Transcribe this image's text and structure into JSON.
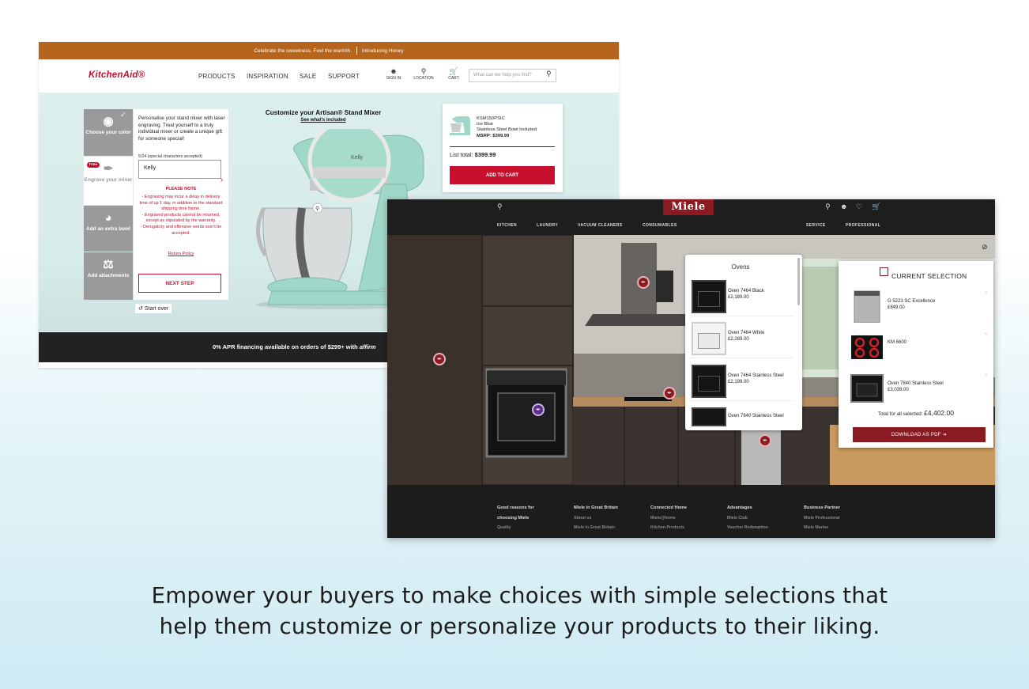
{
  "kitchenaid": {
    "promo": {
      "left": "Celebrate the sweetness. Feel the warmth.",
      "right": "Introducing Honey"
    },
    "logo": "KitchenAid®",
    "nav": [
      "PRODUCTS",
      "INSPIRATION",
      "SALE",
      "SUPPORT"
    ],
    "util": {
      "signin": "SIGN IN",
      "location": "LOCATION",
      "cart": "CART"
    },
    "search_placeholder": "What can we help you find?",
    "steps": [
      {
        "label": "Choose your color",
        "icon": "palette-icon"
      },
      {
        "label": "Engrave your mixer",
        "icon": "pen-nib-icon",
        "badge": "Free"
      },
      {
        "label": "Add an extra bowl",
        "icon": "bowl-icon"
      },
      {
        "label": "Add attachments",
        "icon": "attachments-icon"
      }
    ],
    "panel": {
      "description": "Personalise your stand mixer with laser engraving. Treat yourself to a truly individual mixer or create a unique gift for someone special!",
      "char_count": "5/24 (special characters accepted)",
      "engrave_value": "Kelly",
      "note_title": "PLEASE NOTE",
      "notes": [
        "- Engraving may incur a delay in delivery time of up 1 day, in addition to the standard shipping time frame.",
        "- Engraved products cannot be returned, except as stipulated by the warranty.",
        "- Derogatory and offensive words won't be accepted."
      ],
      "return_link": "Return Policy",
      "next_button": "NEXT STEP"
    },
    "start_over": "Start over",
    "customize_title": "Customize your Artisan® Stand Mixer",
    "whats_included": "See what's included",
    "engraving_preview": "Kelly",
    "card": {
      "sku": "KSM150PSIC",
      "color": "Ice Blue",
      "bowl": "Stainless Steel Bowl Included",
      "msrp": "MSRP: $399.99",
      "total_label": "List total:",
      "total_value": "$399.99",
      "cart_button": "ADD TO CART"
    },
    "footer": "0% APR financing available on orders of $299+ with",
    "footer_brand": "affirm"
  },
  "miele": {
    "logo": "Miele",
    "nav": [
      "KITCHEN",
      "LAUNDRY",
      "VACUUM CLEANERS",
      "CONSUMABLES"
    ],
    "nav_right": [
      "SERVICE",
      "PROFESSIONAL"
    ],
    "ovens_title": "Ovens",
    "ovens": [
      {
        "name": "Oven 7464 Black",
        "price": "£2,189.00",
        "finish": "black"
      },
      {
        "name": "Oven 7464 White",
        "price": "£2,289.00",
        "finish": "white"
      },
      {
        "name": "Oven 7464 Stainless Steel",
        "price": "£2,199.00",
        "finish": "black"
      },
      {
        "name": "Oven 7840 Stainless Steel",
        "price": "",
        "finish": "black"
      }
    ],
    "selection_title": "CURRENT SELECTION",
    "selection": [
      {
        "name": "G 5223 SC Excellence",
        "price": "£849.00",
        "type": "dishwasher"
      },
      {
        "name": "KM 6600",
        "price": "",
        "type": "hob"
      },
      {
        "name": "Oven 7840 Stainless Steel",
        "price": "£3,039.00",
        "type": "oven"
      }
    ],
    "total_label": "Total for all selected:",
    "total_value": "£4,402.00",
    "download_button": "DOWNLOAD AS PDF ➔",
    "footer_cols": [
      {
        "head": [
          "Good reasons for",
          "choosing Miele"
        ],
        "links": [
          "Quality"
        ]
      },
      {
        "head": [
          "Miele in Great Britain"
        ],
        "links": [
          "About us",
          "Miele in Great Britain"
        ]
      },
      {
        "head": [
          "Connected Home"
        ],
        "links": [
          "Miele@home",
          "Kitchen Products"
        ]
      },
      {
        "head": [
          "Advantages"
        ],
        "links": [
          "Miele Club",
          "Voucher Redemption"
        ]
      },
      {
        "head": [
          "Business Partner"
        ],
        "links": [
          "Miele Professional",
          "Miele Marine"
        ]
      }
    ]
  },
  "caption": {
    "line1": "Empower your buyers to make choices with simple selections that",
    "line2": "help them customize or personalize your products to their liking."
  },
  "colors": {
    "kitchenaid_red": "#c8102e",
    "kitchenaid_promo": "#b5651d",
    "miele_red": "#8c1a23",
    "mixer_mint": "#9fd8c8"
  }
}
